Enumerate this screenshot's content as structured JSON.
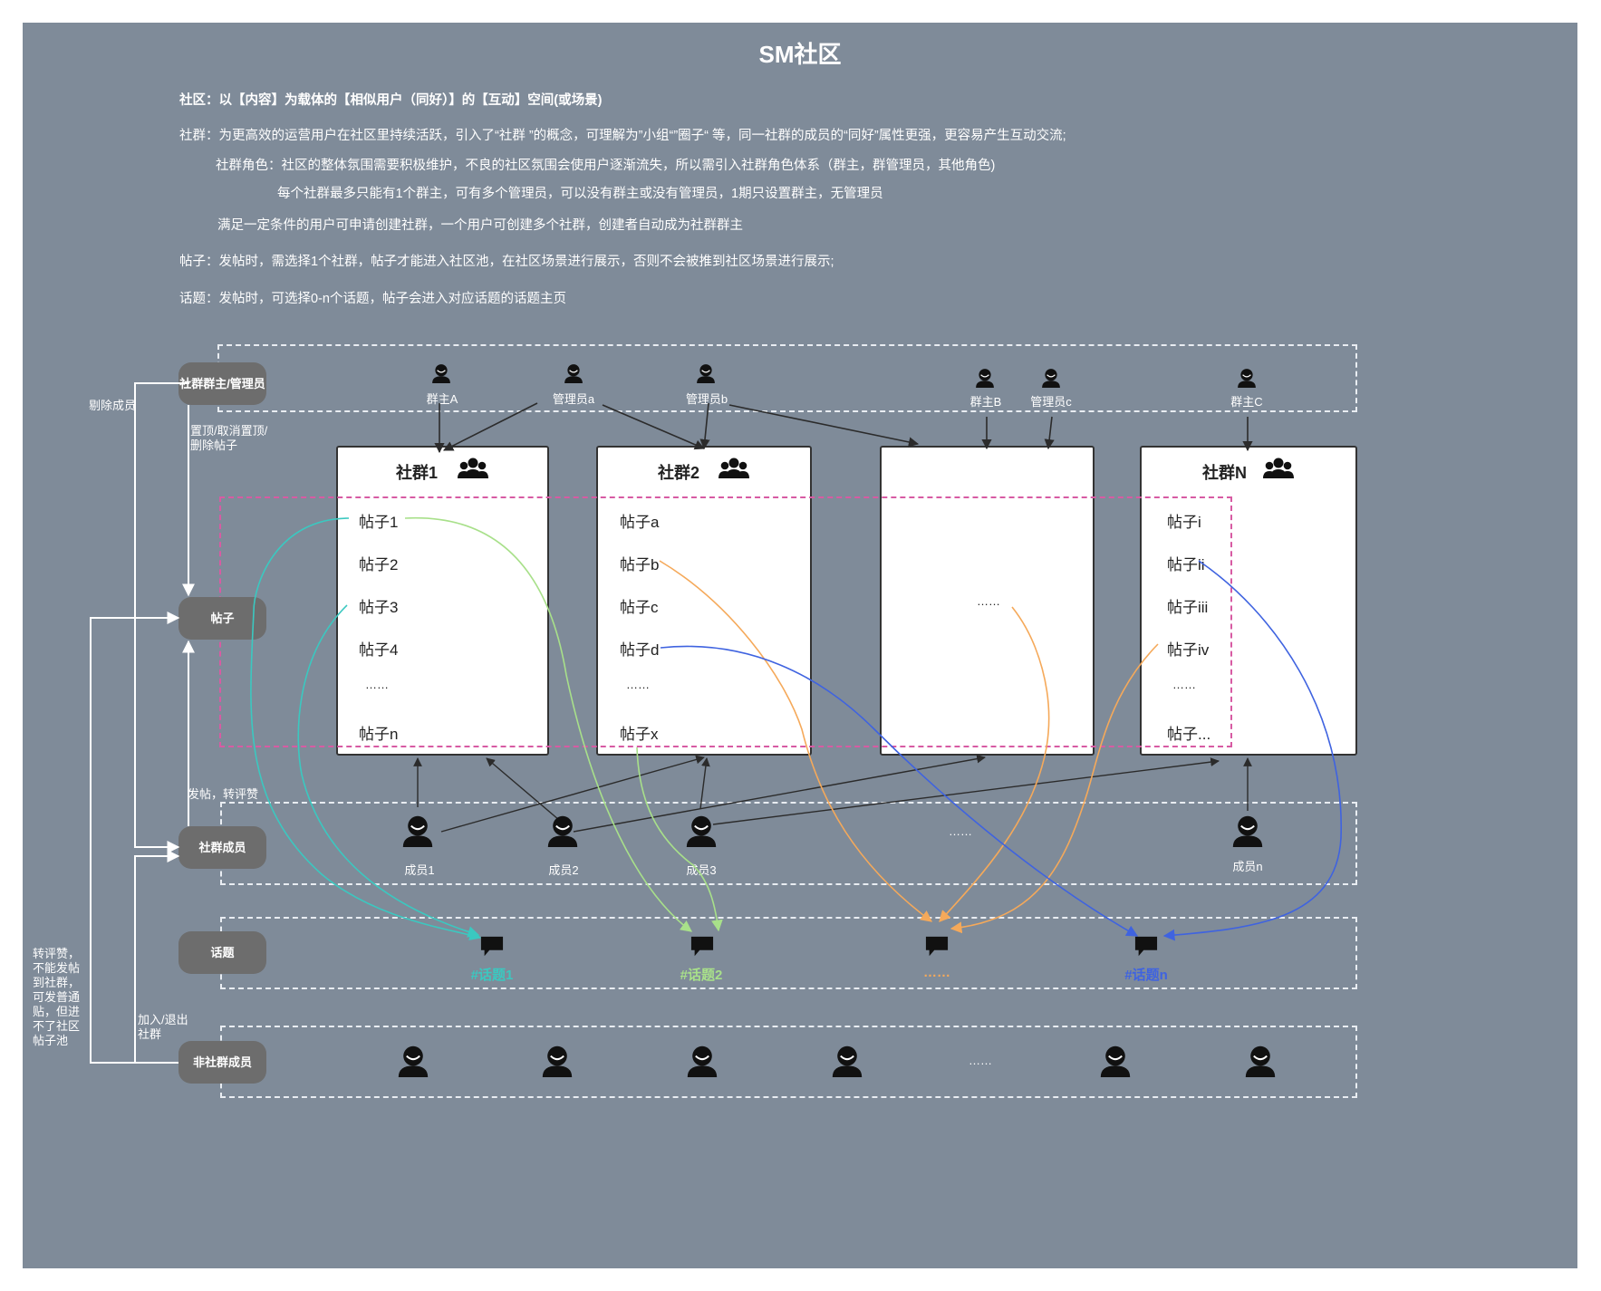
{
  "title": "SM社区",
  "descriptions": {
    "line1": "社区：以【内容】为载体的【相似用户（同好）】的【互动】空间(或场景)",
    "line2": "社群：为更高效的运营用户在社区里持续活跃，引入了“社群 ”的概念，可理解为”小组“”圈子“ 等，同一社群的成员的“同好”属性更强，更容易产生互动交流;",
    "line3": "社群角色：社区的整体氛围需要积极维护，不良的社区氛围会使用户逐渐流失，所以需引入社群角色体系（群主，群管理员，其他角色)",
    "line4": "每个社群最多只能有1个群主，可有多个管理员，可以没有群主或没有管理员，1期只设置群主，无管理员",
    "line5": "满足一定条件的用户可申请创建社群，一个用户可创建多个社群，创建者自动成为社群群主",
    "line6": "帖子：发帖时，需选择1个社群，帖子才能进入社区池，在社区场景进行展示，否则不会被推到社区场景进行展示;",
    "line7": "话题：发帖时，可选择0-n个话题，帖子会进入对应话题的话题主页"
  },
  "roles": {
    "owner_admin": "社群群主/管理员",
    "post": "帖子",
    "member": "社群成员",
    "topic": "话题",
    "non_member": "非社群成员"
  },
  "edge_labels": {
    "remove_member": "剔除成员",
    "pin_delete": "置顶/取消置顶/删除帖子",
    "post_repost": "发帖，转评赞",
    "join_leave": "加入/退出社群",
    "non_member_note": "转评赞，不能发帖到社群，可发普通贴，但进不了社区帖子池"
  },
  "managers": {
    "ownerA": "群主A",
    "adminA": "管理员a",
    "adminB": "管理员b",
    "ownerB": "群主B",
    "adminC": "管理员c",
    "ownerC": "群主C"
  },
  "groups": [
    {
      "title": "社群1",
      "posts": [
        "帖子1",
        "帖子2",
        "帖子3",
        "帖子4",
        "……",
        "帖子n"
      ]
    },
    {
      "title": "社群2",
      "posts": [
        "帖子a",
        "帖子b",
        "帖子c",
        "帖子d",
        "……",
        "帖子x"
      ]
    },
    {
      "title": "",
      "posts": [
        "……"
      ]
    },
    {
      "title": "社群N",
      "posts": [
        "帖子i",
        "帖子ii",
        "帖子iii",
        "帖子iv",
        "……",
        "帖子..."
      ]
    }
  ],
  "members": {
    "m1": "成员1",
    "m2": "成员2",
    "m3": "成员3",
    "ellipsis": "……",
    "mn": "成员n"
  },
  "topics": [
    {
      "label": "#话题1",
      "color": "#3bc8c0"
    },
    {
      "label": "#话题2",
      "color": "#a8e08a"
    },
    {
      "label": "……",
      "color": "#f5a95a"
    },
    {
      "label": "#话题n",
      "color": "#3f63e0"
    }
  ],
  "non_members_ellipsis": "……",
  "colors": {
    "background": "#7f8b99",
    "pill": "#6d6d6d",
    "pink_dash": "#d75ba3",
    "topic1": "#3bc8c0",
    "topic2": "#a8e08a",
    "topic3": "#f5a95a",
    "topicN": "#3f63e0"
  }
}
